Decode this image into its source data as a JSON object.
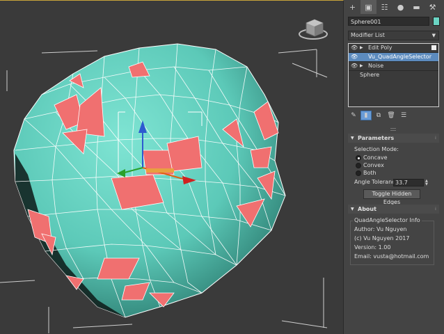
{
  "command_panel": {
    "tabs": [
      {
        "icon": "create-icon",
        "glyph": "+"
      },
      {
        "icon": "modify-icon",
        "glyph": "▣"
      },
      {
        "icon": "hierarchy-icon",
        "glyph": "☷"
      },
      {
        "icon": "motion-icon",
        "glyph": "●"
      },
      {
        "icon": "display-icon",
        "glyph": "▬"
      },
      {
        "icon": "utilities-icon",
        "glyph": "⚒"
      }
    ],
    "object_name": "Sphere001",
    "object_color": "#6bd5c4",
    "modifier_list_label": "Modifier List",
    "stack": [
      {
        "label": "Edit Poly",
        "selected": false
      },
      {
        "label": "Vu_QuadAngleSelector",
        "selected": true
      },
      {
        "label": "Noise",
        "selected": false
      }
    ],
    "stack_base": "Sphere"
  },
  "parameters": {
    "title": "Parameters",
    "selection_mode_label": "Selection Mode:",
    "options": [
      {
        "label": "Concave",
        "selected": true
      },
      {
        "label": "Convex",
        "selected": false
      },
      {
        "label": "Both",
        "selected": false
      }
    ],
    "angle_tolerance_label": "Angle Tolerance",
    "angle_tolerance_value": "33.7",
    "toggle_button": "Toggle Hidden Edges"
  },
  "about": {
    "title": "About",
    "group_title": "QuadAngleSelector Info",
    "author": "Author: Vu Nguyen",
    "copyright": "(c) Vu Nguyen 2017",
    "version": "Version: 1.00",
    "email": "Email: vusta@hotmail.com"
  },
  "colors": {
    "mesh": "#6bd5c4",
    "selected_faces": "#f07070",
    "selection_highlight": "#5c8bbe"
  }
}
